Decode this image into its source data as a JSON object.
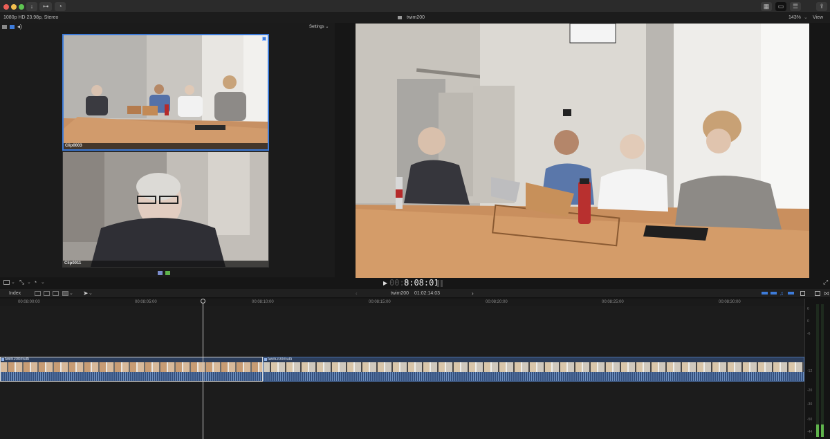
{
  "window": {
    "title": "twim200",
    "format": "1080p HD 23.98p, Stereo",
    "zoom": "143%",
    "view_label": "View"
  },
  "angle_viewer": {
    "settings_label": "Settings",
    "angles": [
      {
        "label": "Clip0003",
        "active": true
      },
      {
        "label": "Clip0011",
        "active": false
      }
    ]
  },
  "playback": {
    "timecode_dim": "00:0",
    "timecode": "8:08:01"
  },
  "timeline": {
    "index_label": "Index",
    "project_name": "twim200",
    "duration": "01:02:14:03",
    "ruler": [
      "00:08:00:00",
      "00:08:05:00",
      "00:08:10:00",
      "00:08:15:00",
      "00:08:20:00",
      "00:08:25:00",
      "00:08:30:00"
    ],
    "clips": [
      {
        "name": "twim200multi",
        "selected": true
      },
      {
        "name": "twim200multi",
        "selected": false
      }
    ]
  },
  "meters": {
    "scale": [
      "6",
      "0",
      "-6",
      "-12",
      "-20",
      "-30",
      "-50",
      "-44"
    ]
  },
  "colors": {
    "accent": "#3d7bd9",
    "playhead": "#c8c8c8",
    "clip_selected_border": "#d8d8d8",
    "meter_green": "#5fb34c"
  }
}
